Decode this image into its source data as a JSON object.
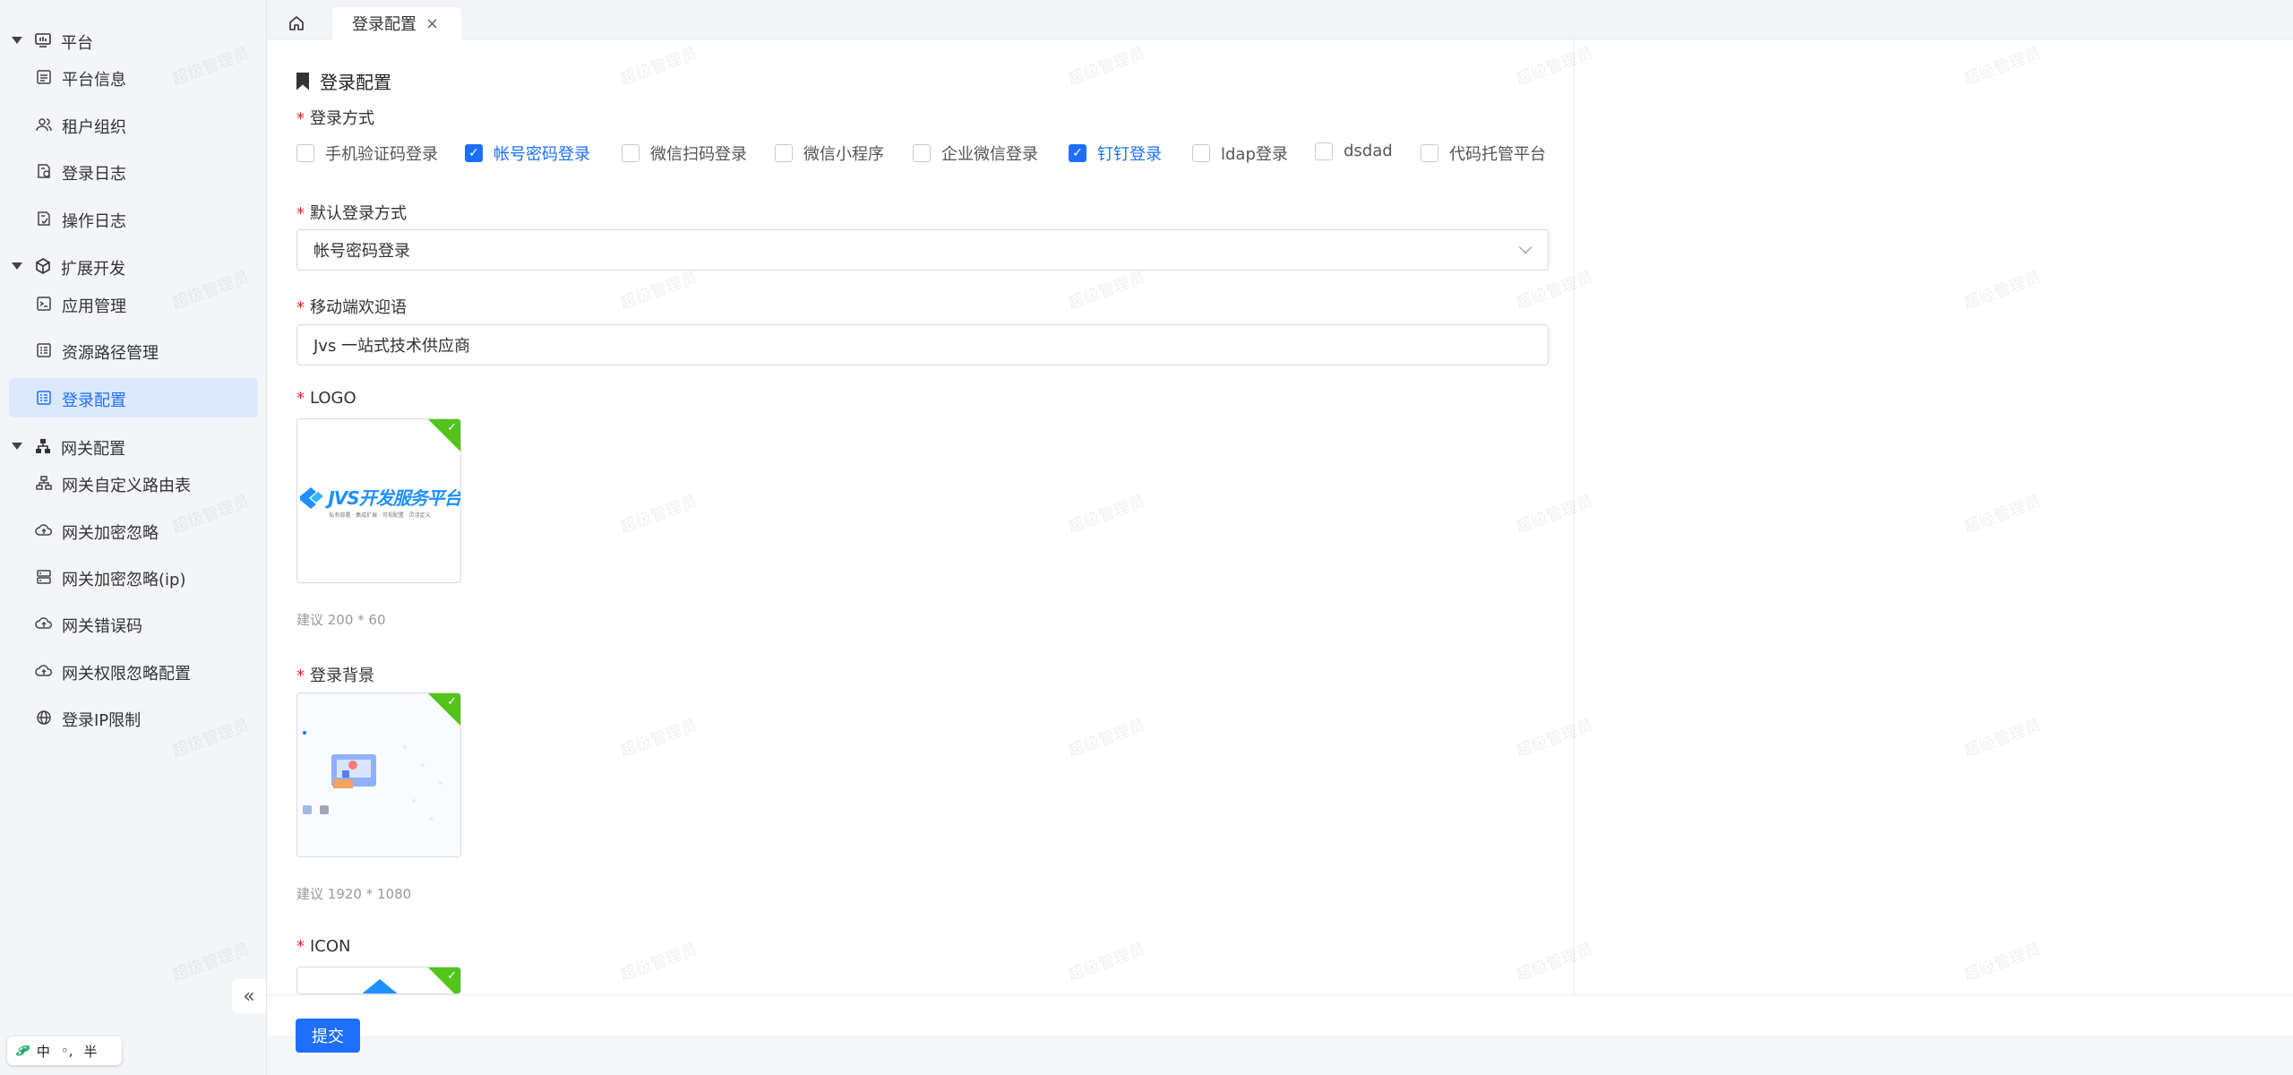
{
  "sidebar": {
    "groups": [
      {
        "label": "平台",
        "icon": "monitor-icon",
        "items": [
          {
            "label": "平台信息",
            "icon": "document-icon"
          },
          {
            "label": "租户组织",
            "icon": "users-icon"
          },
          {
            "label": "登录日志",
            "icon": "log-icon"
          },
          {
            "label": "操作日志",
            "icon": "operation-log-icon"
          }
        ]
      },
      {
        "label": "扩展开发",
        "icon": "cube-icon",
        "items": [
          {
            "label": "应用管理",
            "icon": "terminal-icon"
          },
          {
            "label": "资源路径管理",
            "icon": "list-icon"
          },
          {
            "label": "登录配置",
            "icon": "list-icon",
            "active": true
          }
        ]
      },
      {
        "label": "网关配置",
        "icon": "gateway-icon",
        "items": [
          {
            "label": "网关自定义路由表",
            "icon": "route-icon"
          },
          {
            "label": "网关加密忽略",
            "icon": "cloud-icon"
          },
          {
            "label": "网关加密忽略(ip)",
            "icon": "server-icon"
          },
          {
            "label": "网关错误码",
            "icon": "cloud-icon"
          },
          {
            "label": "网关权限忽略配置",
            "icon": "cloud-icon"
          },
          {
            "label": "登录IP限制",
            "icon": "globe-icon"
          }
        ]
      }
    ],
    "collapse_label": "«"
  },
  "ime": {
    "logo": "𝓟",
    "lang": "中",
    "punct": "◦,",
    "width": "半"
  },
  "tabs": {
    "active_label": "登录配置",
    "close": "×"
  },
  "form": {
    "title": "登录配置",
    "login_methods_label": "登录方式",
    "login_methods": [
      {
        "label": "手机验证码登录",
        "checked": false
      },
      {
        "label": "帐号密码登录",
        "checked": true
      },
      {
        "label": "微信扫码登录",
        "checked": false
      },
      {
        "label": "微信小程序",
        "checked": false
      },
      {
        "label": "企业微信登录",
        "checked": false
      },
      {
        "label": "钉钉登录",
        "checked": true
      },
      {
        "label": "ldap登录",
        "checked": false
      },
      {
        "label": "dsdad",
        "checked": false
      },
      {
        "label": "代码托管平台",
        "checked": false
      }
    ],
    "default_method_label": "默认登录方式",
    "default_method_value": "帐号密码登录",
    "welcome_label": "移动端欢迎语",
    "welcome_value": "Jvs 一站式技术供应商",
    "logo_label": "LOGO",
    "logo_image_text": "JVS开发服务平台",
    "logo_image_subtext": "私有部署 · 集成扩展 · 可视配置 · 灵活定义",
    "logo_hint": "建议 200 * 60",
    "bg_label": "登录背景",
    "bg_hint": "建议 1920 * 1080",
    "icon_label": "ICON",
    "submit_label": "提交"
  },
  "watermark_text": "超级管理员",
  "colors": {
    "primary": "#1e6fff",
    "success": "#52c41a",
    "required": "#f5222d",
    "active_bg": "#dce9fc"
  }
}
